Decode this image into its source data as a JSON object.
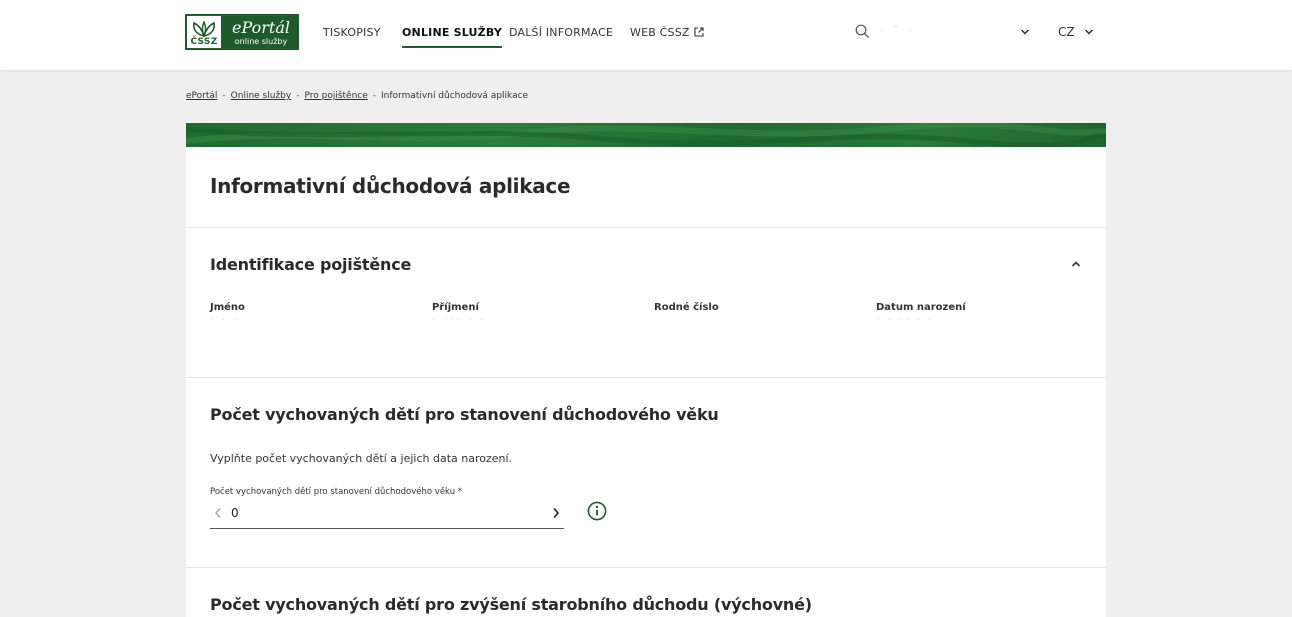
{
  "header": {
    "logo": {
      "mark_text": "ČSSZ",
      "brand": "ePortál",
      "brand_sub": "online služby"
    },
    "nav": [
      {
        "label": "TISKOPISY",
        "active": false
      },
      {
        "label": "ONLINE SLUŽBY",
        "active": true
      },
      {
        "label": "DALŠÍ INFORMACE",
        "active": false
      },
      {
        "label": "WEB ČSSZ",
        "active": false,
        "icon": "external-link-icon"
      }
    ],
    "search_icon": "search-icon",
    "user_name": "·  ˘ ·",
    "language": "CZ"
  },
  "breadcrumb": {
    "items": [
      "ePortál",
      "Online služby",
      "Pro pojištěnce"
    ],
    "current": "Informativní důchodová aplikace",
    "separator": "-"
  },
  "page": {
    "title": "Informativní důchodová aplikace"
  },
  "identification": {
    "title": "Identifikace pojištěnce",
    "fields": [
      {
        "label": "Jméno",
        "value": "˙ ˙  ˙"
      },
      {
        "label": "Příjmení",
        "value": "˙  ˙˙˙ ˙ ˙"
      },
      {
        "label": "Rodné číslo",
        "value": ""
      },
      {
        "label": "Datum narození",
        "value": "˙ ˙ ˙˙ ˙ ˙"
      }
    ]
  },
  "children_age": {
    "title": "Počet vychovaných dětí pro stanovení důchodového věku",
    "hint": "Vyplňte počet vychovaných dětí a jejich data narození.",
    "field_label": "Počet vychovaných dětí pro stanovení důchodového věku *",
    "value": "0"
  },
  "children_bonus": {
    "title": "Počet vychovaných dětí pro zvýšení starobního důchodu (výchovné)"
  },
  "colors": {
    "brand_green": "#1f5b2a",
    "banner_green": "#2a7a38"
  }
}
